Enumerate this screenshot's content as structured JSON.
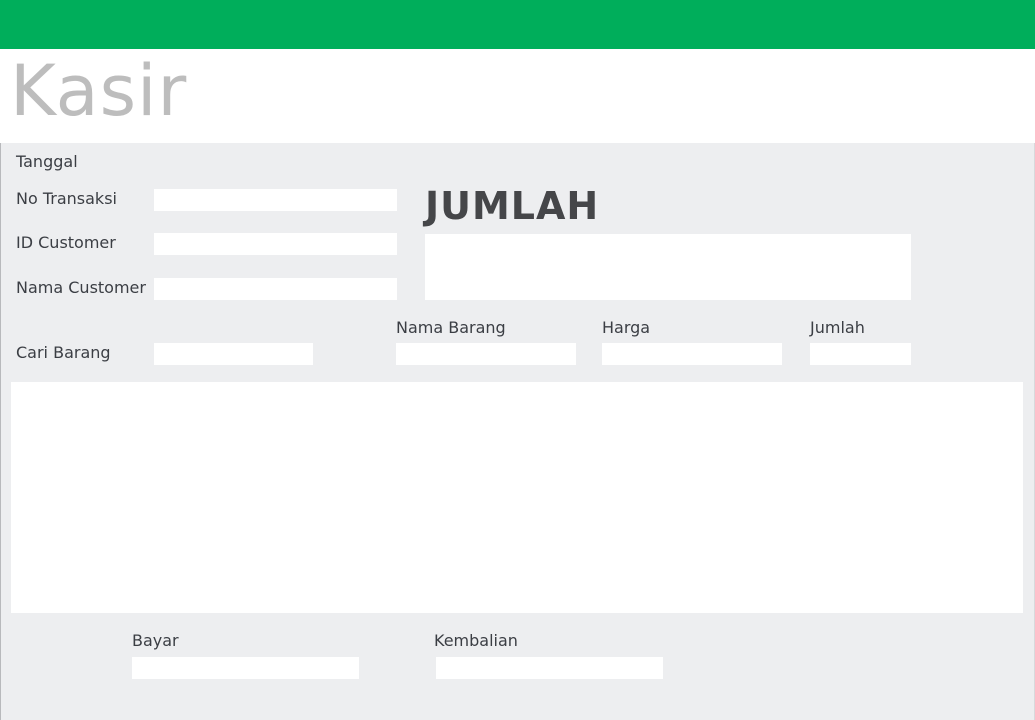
{
  "colors": {
    "header_bar": "#00ae5b",
    "title_text": "#bdbdbd",
    "panel_bg": "#edeef0",
    "label_text": "#3b3e44",
    "total_heading": "#454649"
  },
  "header": {
    "title": "Kasir"
  },
  "transaction": {
    "date_label": "Tanggal",
    "no_transaksi_label": "No Transaksi",
    "no_transaksi_value": "",
    "id_customer_label": "ID Customer",
    "id_customer_value": "",
    "nama_customer_label": "Nama Customer",
    "nama_customer_value": ""
  },
  "total": {
    "heading": "JUMLAH",
    "value": ""
  },
  "item_entry": {
    "cari_barang_label": "Cari Barang",
    "cari_barang_value": "",
    "nama_barang_label": "Nama Barang",
    "nama_barang_value": "",
    "harga_label": "Harga",
    "harga_value": "",
    "jumlah_label": "Jumlah",
    "jumlah_value": ""
  },
  "payment": {
    "bayar_label": "Bayar",
    "bayar_value": "",
    "kembalian_label": "Kembalian",
    "kembalian_value": ""
  }
}
